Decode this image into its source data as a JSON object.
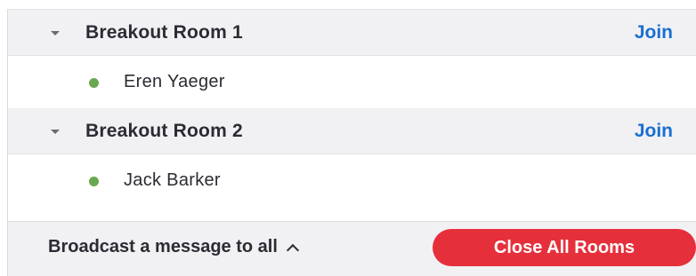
{
  "rooms": [
    {
      "title": "Breakout Room 1",
      "join_label": "Join",
      "participants": [
        {
          "name": "Eren Yaeger",
          "status_color": "#6aa84f"
        }
      ]
    },
    {
      "title": "Breakout Room 2",
      "join_label": "Join",
      "participants": [
        {
          "name": "Jack Barker",
          "status_color": "#6aa84f"
        }
      ]
    }
  ],
  "footer": {
    "broadcast_label": "Broadcast a message to all",
    "close_all_label": "Close All Rooms"
  },
  "colors": {
    "accent": "#1a6fd1",
    "danger": "#e5303c",
    "status_online": "#6aa84f"
  },
  "icons": {
    "room_collapse": "caret-down-icon",
    "participant_status": "status-dot-icon",
    "broadcast_toggle": "chevron-up-icon"
  }
}
